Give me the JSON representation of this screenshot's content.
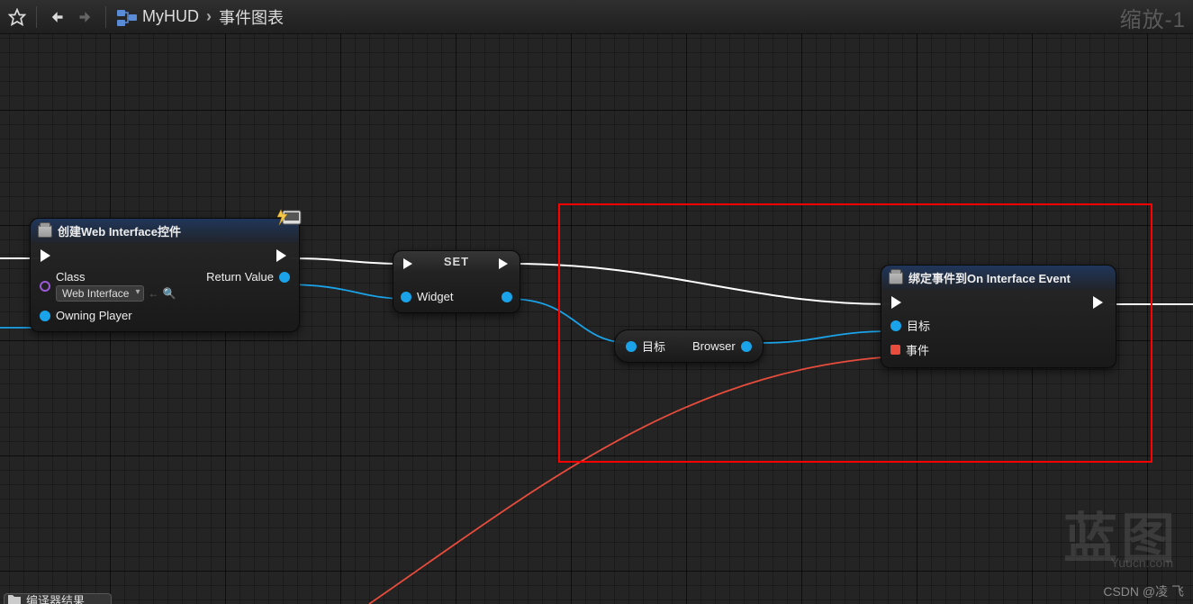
{
  "toolbar": {
    "breadcrumb": {
      "item1": "MyHUD",
      "item2": "事件图表"
    },
    "zoom_label": "缩放-1"
  },
  "nodes": {
    "create": {
      "title": "创建Web Interface控件",
      "pins": {
        "class_label": "Class",
        "class_value": "Web Interface",
        "owning_player": "Owning Player",
        "return_value": "Return Value"
      }
    },
    "set": {
      "title": "SET",
      "widget_label": "Widget"
    },
    "get_browser": {
      "left_label": "目标",
      "right_label": "Browser"
    },
    "bind": {
      "title": "绑定事件到On Interface Event",
      "target_label": "目标",
      "event_label": "事件"
    }
  },
  "watermark": {
    "big": "蓝图",
    "small": "Yuucn.com"
  },
  "credit": "CSDN @凌 飞",
  "bottom_tab": "编译器结果"
}
